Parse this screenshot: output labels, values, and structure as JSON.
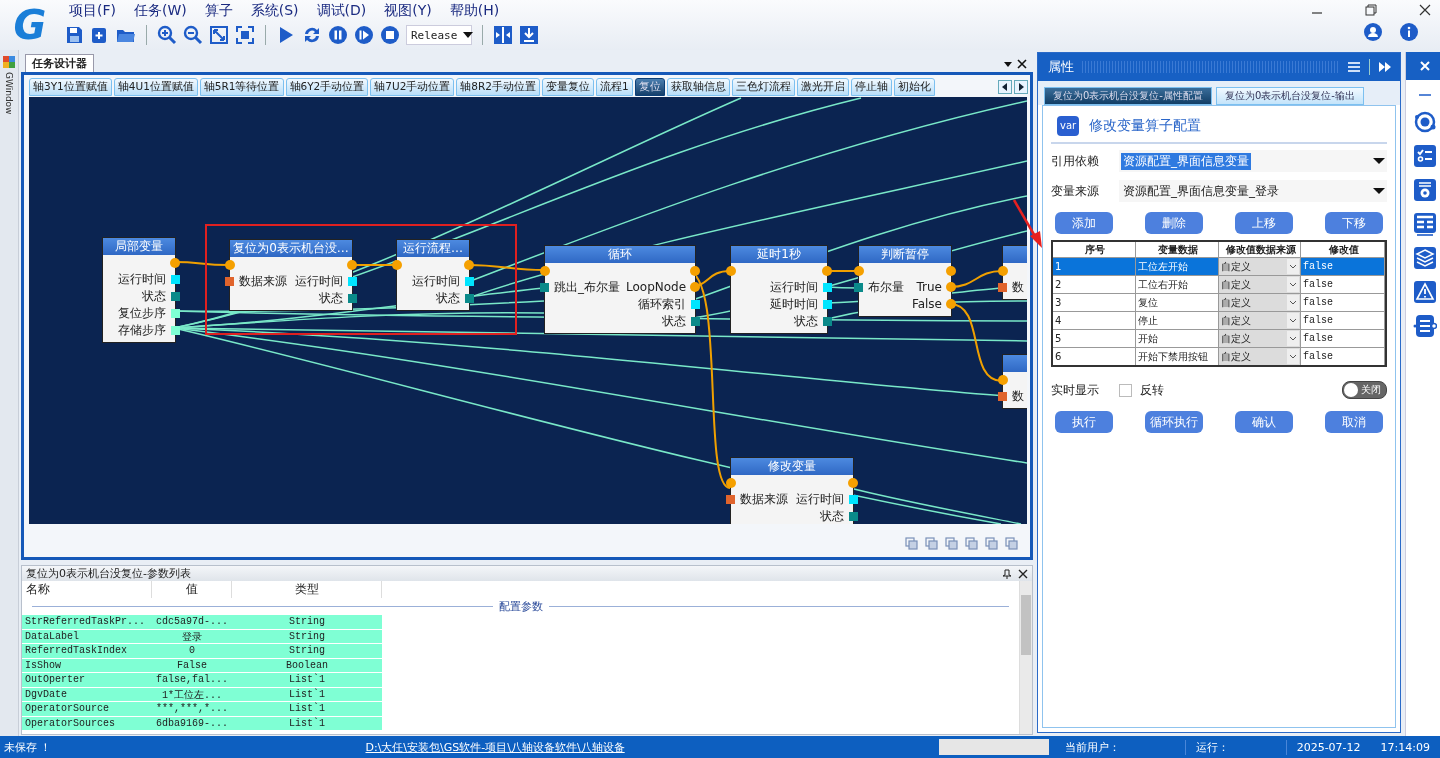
{
  "logo": {
    "text": "G"
  },
  "menu": [
    "项目(F)",
    "任务(W)",
    "算子",
    "系统(S)",
    "调试(D)",
    "视图(Y)",
    "帮助(H)"
  ],
  "toolbar": {
    "build_config": "Release"
  },
  "left_strip": {
    "label": "GWindow"
  },
  "designer": {
    "title": "任务设计器",
    "tabs": [
      {
        "label": "轴3Y1位置赋值",
        "selected": false
      },
      {
        "label": "轴4U1位置赋值",
        "selected": false
      },
      {
        "label": "轴5R1等待位置",
        "selected": false
      },
      {
        "label": "轴6Y2手动位置",
        "selected": false
      },
      {
        "label": "轴7U2手动位置",
        "selected": false
      },
      {
        "label": "轴8R2手动位置",
        "selected": false
      },
      {
        "label": "变量复位",
        "selected": false
      },
      {
        "label": "流程1",
        "selected": false
      },
      {
        "label": "复位",
        "selected": true
      },
      {
        "label": "获取轴信息",
        "selected": false
      },
      {
        "label": "三色灯流程",
        "selected": false
      },
      {
        "label": "激光开启",
        "selected": false
      },
      {
        "label": "停止轴",
        "selected": false
      },
      {
        "label": "初始化",
        "selected": false
      }
    ],
    "nodes": [
      {
        "title": "局部变量",
        "flow_in": false,
        "flow_out": true,
        "outputs": [
          {
            "label": "运行时间",
            "kind": "data",
            "color": "#00e5ff"
          },
          {
            "label": "状态",
            "kind": "data",
            "color": "#0a8a8a"
          },
          {
            "label": "复位步序",
            "kind": "data",
            "color": "#7fffd4"
          },
          {
            "label": "存储步序",
            "kind": "data",
            "color": "#7fffd4"
          }
        ]
      },
      {
        "title": "复位为0表示机台没…",
        "flow_in": true,
        "flow_out": true,
        "inputs": [
          {
            "label": "数据来源",
            "kind": "data",
            "color": "#e0642c"
          }
        ],
        "outputs": [
          {
            "label": "运行时间",
            "kind": "data",
            "color": "#00e5ff"
          },
          {
            "label": "状态",
            "kind": "data",
            "color": "#0a8a8a"
          }
        ]
      },
      {
        "title": "运行流程…",
        "flow_in": true,
        "flow_out": true,
        "outputs": [
          {
            "label": "运行时间",
            "kind": "data",
            "color": "#00e5ff"
          },
          {
            "label": "状态",
            "kind": "data",
            "color": "#0a8a8a"
          }
        ]
      },
      {
        "title": "循环",
        "flow_in": true,
        "flow_out": true,
        "inputs": [
          {
            "label": "跳出_布尔量",
            "kind": "data",
            "color": "#0a8a8a"
          }
        ],
        "outputs": [
          {
            "label": "LoopNode",
            "kind": "flow",
            "color": "#f5a000"
          },
          {
            "label": "循环索引",
            "kind": "data",
            "color": "#00e5ff"
          },
          {
            "label": "状态",
            "kind": "data",
            "color": "#0a8a8a"
          }
        ]
      },
      {
        "title": "延时1秒",
        "flow_in": true,
        "flow_out": true,
        "outputs": [
          {
            "label": "运行时间",
            "kind": "data",
            "color": "#00e5ff"
          },
          {
            "label": "延时时间",
            "kind": "data",
            "color": "#00e5ff"
          },
          {
            "label": "状态",
            "kind": "data",
            "color": "#0a8a8a"
          }
        ]
      },
      {
        "title": "判断暂停",
        "flow_in": true,
        "flow_out": true,
        "inputs": [
          {
            "label": "布尔量",
            "kind": "data",
            "color": "#0a8a8a"
          }
        ],
        "outputs": [
          {
            "label": "True",
            "kind": "flow",
            "color": "#f5a000"
          },
          {
            "label": "False",
            "kind": "flow",
            "color": "#f5a000"
          }
        ]
      },
      {
        "flow_in": true,
        "flow_out": false,
        "inputs": [
          {
            "label": "数",
            "kind": "data",
            "color": "#e0642c"
          }
        ]
      },
      {
        "flow_in": true,
        "flow_out": false,
        "inputs": [
          {
            "label": "数",
            "kind": "data",
            "color": "#e0642c"
          }
        ]
      },
      {
        "title": "修改变量",
        "flow_in": true,
        "flow_out": true,
        "inputs": [
          {
            "label": "数据来源",
            "kind": "data",
            "color": "#e0642c"
          }
        ],
        "outputs": [
          {
            "label": "运行时间",
            "kind": "data",
            "color": "#00e5ff"
          },
          {
            "label": "状态",
            "kind": "data",
            "color": "#0a8a8a"
          }
        ]
      }
    ]
  },
  "param_panel": {
    "title": "复位为0表示机台没复位-参数列表",
    "columns": [
      "名称",
      "值",
      "类型"
    ],
    "group": "配置参数",
    "rows": [
      {
        "name": "StrReferredTaskPr...",
        "value": "cdc5a97d-...",
        "type": "String"
      },
      {
        "name": "DataLabel",
        "value": "登录",
        "type": "String"
      },
      {
        "name": "ReferredTaskIndex",
        "value": "0",
        "type": "String"
      },
      {
        "name": "IsShow",
        "value": "False",
        "type": "Boolean"
      },
      {
        "name": "OutOperter",
        "value": "false,fal...",
        "type": "List`1"
      },
      {
        "name": "DgvDate",
        "value": "1*工位左...",
        "type": "List`1"
      },
      {
        "name": "OperatorSource",
        "value": "***,***,*...",
        "type": "List`1"
      },
      {
        "name": "OperatorSources",
        "value": "6dba9169-...",
        "type": "List`1"
      }
    ]
  },
  "properties": {
    "title": "属性",
    "tabs": [
      {
        "label": "复位为0表示机台没复位-属性配置",
        "selected": true
      },
      {
        "label": "复位为0表示机台没复位-输出",
        "selected": false
      }
    ],
    "icon_label": "var",
    "heading": "修改变量算子配置",
    "fields": [
      {
        "label": "引用依赖",
        "value": "资源配置_界面信息变量",
        "highlighted": true
      },
      {
        "label": "变量来源",
        "value": "资源配置_界面信息变量_登录",
        "highlighted": false
      }
    ],
    "buttons": [
      "添加",
      "删除",
      "上移",
      "下移"
    ],
    "table": {
      "columns": [
        "序号",
        "变量数据",
        "修改值数据来源",
        "修改值"
      ],
      "rows": [
        {
          "index": "1",
          "variable": "工位左开始",
          "source": "自定义",
          "value": "false",
          "selected": true
        },
        {
          "index": "2",
          "variable": "工位右开始",
          "source": "自定义",
          "value": "false",
          "selected": false
        },
        {
          "index": "3",
          "variable": "复位",
          "source": "自定义",
          "value": "false",
          "selected": false
        },
        {
          "index": "4",
          "variable": "停止",
          "source": "自定义",
          "value": "false",
          "selected": false
        },
        {
          "index": "5",
          "variable": "开始",
          "source": "自定义",
          "value": "false",
          "selected": false
        },
        {
          "index": "6",
          "variable": "开始下禁用按钮",
          "source": "自定义",
          "value": "false",
          "selected": false
        }
      ]
    },
    "options": {
      "label": "实时显示",
      "checkbox": {
        "label": "反转",
        "checked": false
      },
      "toggle": {
        "label": "关闭",
        "on": false
      }
    },
    "actions": [
      "执行",
      "循环执行",
      "确认",
      "取消"
    ]
  },
  "status_bar": {
    "save_state": "未保存 ！",
    "path": "D:\\大任\\安装包\\GS软件-项目\\八轴设备软件\\八轴设备",
    "user_label": "当前用户：",
    "run_label": "运行：",
    "date": "2025-07-12",
    "time": "17:14:09"
  }
}
